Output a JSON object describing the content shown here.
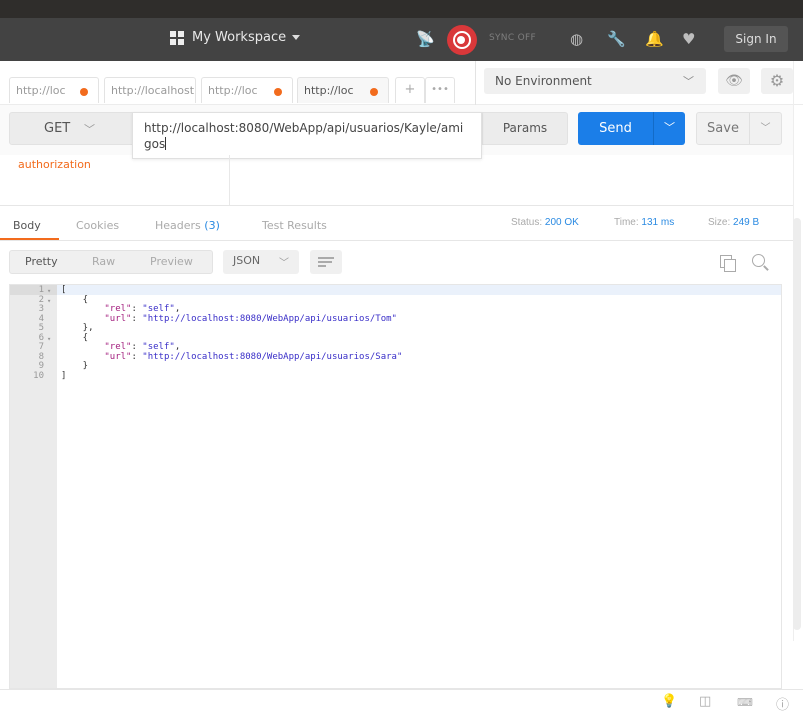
{
  "header": {
    "workspace_label": "My Workspace",
    "sync_status": "SYNC OFF",
    "sign_in_label": "Sign In",
    "icons": [
      "satellite-icon",
      "sync-icon",
      "globe-icon",
      "wrench-icon",
      "bell-icon",
      "heart-icon"
    ]
  },
  "request_tabs": [
    {
      "label": "http://loc",
      "unsaved": true,
      "active": false
    },
    {
      "label": "http://localhost",
      "unsaved": false,
      "active": false
    },
    {
      "label": "http://loc",
      "unsaved": true,
      "active": false
    },
    {
      "label": "http://loc",
      "unsaved": true,
      "active": true
    }
  ],
  "tab_actions": {
    "new_tab": "+",
    "more": "•••"
  },
  "environment": {
    "selected": "No Environment"
  },
  "request": {
    "method": "GET",
    "url": "http://localhost:8080/WebApp/api/usuarios/Kayle/amigos",
    "params_label": "Params",
    "send_label": "Send",
    "save_label": "Save"
  },
  "request_section": {
    "auth_label": "authorization"
  },
  "response": {
    "tabs": [
      {
        "label": "Body",
        "active": true
      },
      {
        "label": "Cookies",
        "active": false
      },
      {
        "label": "Headers",
        "count": "(3)",
        "active": false
      },
      {
        "label": "Test Results",
        "active": false
      }
    ],
    "status_label": "Status:",
    "status_value": "200 OK",
    "time_label": "Time:",
    "time_value": "131 ms",
    "size_label": "Size:",
    "size_value": "249 B",
    "view_modes": [
      {
        "label": "Pretty",
        "active": true
      },
      {
        "label": "Raw",
        "active": false
      },
      {
        "label": "Preview",
        "active": false
      }
    ],
    "format": "JSON",
    "body_lines": [
      {
        "n": "1",
        "fold": true,
        "text": "["
      },
      {
        "n": "2",
        "fold": true,
        "text": "    {"
      },
      {
        "n": "3",
        "fold": false,
        "key": "rel",
        "value": "self",
        "comma": true
      },
      {
        "n": "4",
        "fold": false,
        "key": "url",
        "value": "http://localhost:8080/WebApp/api/usuarios/Tom",
        "comma": false
      },
      {
        "n": "5",
        "fold": false,
        "text": "    },"
      },
      {
        "n": "6",
        "fold": true,
        "text": "    {"
      },
      {
        "n": "7",
        "fold": false,
        "key": "rel",
        "value": "self",
        "comma": true
      },
      {
        "n": "8",
        "fold": false,
        "key": "url",
        "value": "http://localhost:8080/WebApp/api/usuarios/Sara",
        "comma": false
      },
      {
        "n": "9",
        "fold": false,
        "text": "    }"
      },
      {
        "n": "10",
        "fold": false,
        "text": "]"
      }
    ]
  },
  "footer": {
    "icons": [
      "lightbulb-icon",
      "two-pane-icon",
      "keyboard-icon",
      "help-icon"
    ]
  },
  "colors": {
    "accent": "#f26b1d",
    "send": "#1b7ee8",
    "link": "#2a8ae2",
    "sync": "#d9383a"
  }
}
